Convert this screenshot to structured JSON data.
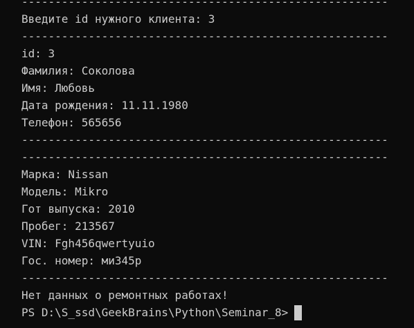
{
  "terminal": {
    "lines": [
      {
        "kind": "separator",
        "text": "-------------------------------------------------------"
      },
      {
        "kind": "text",
        "text": "Введите id нужного клиента: 3"
      },
      {
        "kind": "separator",
        "text": "-------------------------------------------------------"
      },
      {
        "kind": "text",
        "text": "id: 3"
      },
      {
        "kind": "text",
        "text": "Фамилия: Соколова"
      },
      {
        "kind": "text",
        "text": "Имя: Любовь"
      },
      {
        "kind": "text",
        "text": "Дата рождения: 11.11.1980"
      },
      {
        "kind": "text",
        "text": "Телефон: 565656"
      },
      {
        "kind": "separator",
        "text": "-------------------------------------------------------"
      },
      {
        "kind": "separator",
        "text": "-------------------------------------------------------"
      },
      {
        "kind": "text",
        "text": "Марка: Nissan"
      },
      {
        "kind": "text",
        "text": "Модель: Mikro"
      },
      {
        "kind": "text",
        "text": "Гот выпуска: 2010"
      },
      {
        "kind": "text",
        "text": "Пробег: 213567"
      },
      {
        "kind": "text",
        "text": "VIN: Fgh456qwertyuio"
      },
      {
        "kind": "text",
        "text": "Гос. номер: ми345р"
      },
      {
        "kind": "separator",
        "text": "-------------------------------------------------------"
      },
      {
        "kind": "text",
        "text": "Нет данных о ремонтных работах!"
      }
    ],
    "prompt": "PS D:\\S_ssd\\GeekBrains\\Python\\Seminar_8>"
  },
  "colors": {
    "background": "#0c0c0c",
    "foreground": "#cccccc"
  }
}
